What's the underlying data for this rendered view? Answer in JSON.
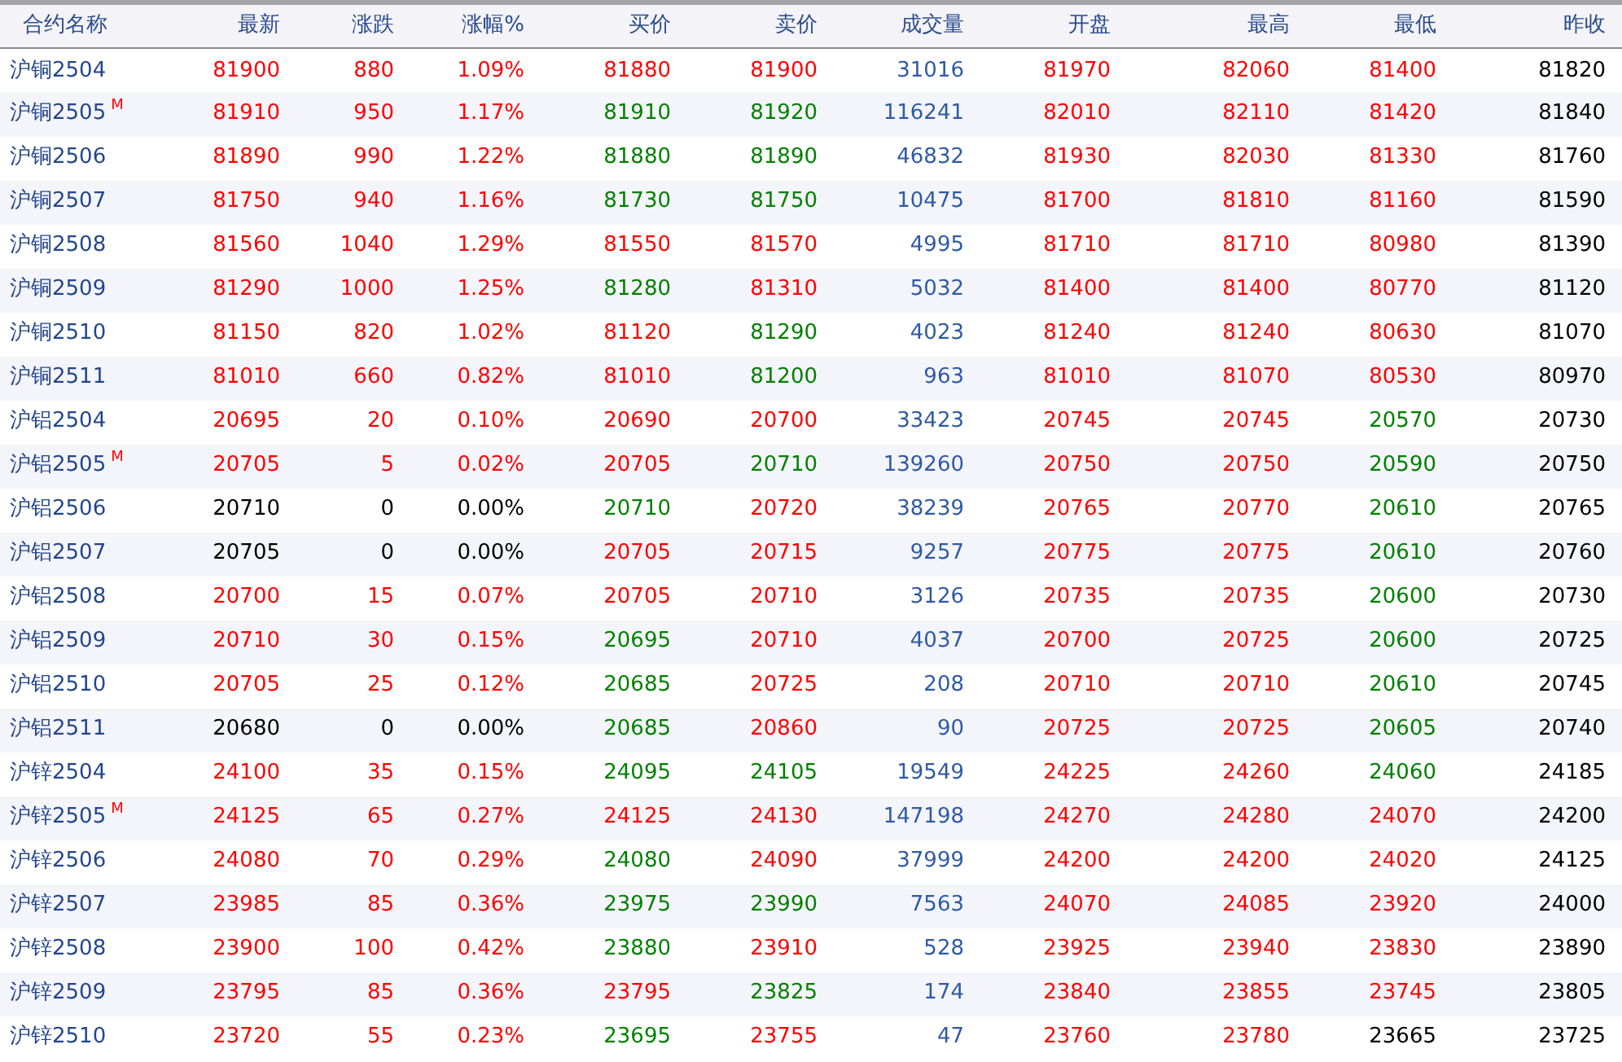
{
  "columns": [
    {
      "label": "合约名称",
      "kind": "name"
    },
    {
      "label": "最新",
      "kind": "price"
    },
    {
      "label": "涨跌",
      "kind": "price"
    },
    {
      "label": "涨幅%",
      "kind": "price"
    },
    {
      "label": "买价",
      "kind": "price"
    },
    {
      "label": "卖价",
      "kind": "price"
    },
    {
      "label": "成交量",
      "kind": "volume"
    },
    {
      "label": "开盘",
      "kind": "price"
    },
    {
      "label": "最高",
      "kind": "price"
    },
    {
      "label": "最低",
      "kind": "price"
    },
    {
      "label": "昨收",
      "kind": "close"
    }
  ],
  "rows": [
    {
      "name": "沪铜2504",
      "cells": [
        {
          "text": "81900",
          "color": "#ff0000"
        },
        {
          "text": "880",
          "color": "#ff0000"
        },
        {
          "text": "1.09%",
          "color": "#ff0000"
        },
        {
          "text": "81880",
          "color": "#ff0000"
        },
        {
          "text": "81900",
          "color": "#ff0000"
        },
        {
          "text": "31016"
        },
        {
          "text": "81970",
          "color": "#ff0000"
        },
        {
          "text": "82060",
          "color": "#ff0000"
        },
        {
          "text": "81400",
          "color": "#ff0000"
        },
        {
          "text": "81820"
        }
      ]
    },
    {
      "name": "沪铜2505",
      "badge": "M",
      "cells": [
        {
          "text": "81910",
          "color": "#ff0000"
        },
        {
          "text": "950",
          "color": "#ff0000"
        },
        {
          "text": "1.17%",
          "color": "#ff0000"
        },
        {
          "text": "81910",
          "color": "#008000"
        },
        {
          "text": "81920",
          "color": "#008000"
        },
        {
          "text": "116241"
        },
        {
          "text": "82010",
          "color": "#ff0000"
        },
        {
          "text": "82110",
          "color": "#ff0000"
        },
        {
          "text": "81420",
          "color": "#ff0000"
        },
        {
          "text": "81840"
        }
      ]
    },
    {
      "name": "沪铜2506",
      "cells": [
        {
          "text": "81890",
          "color": "#ff0000"
        },
        {
          "text": "990",
          "color": "#ff0000"
        },
        {
          "text": "1.22%",
          "color": "#ff0000"
        },
        {
          "text": "81880",
          "color": "#008000"
        },
        {
          "text": "81890",
          "color": "#008000"
        },
        {
          "text": "46832"
        },
        {
          "text": "81930",
          "color": "#ff0000"
        },
        {
          "text": "82030",
          "color": "#ff0000"
        },
        {
          "text": "81330",
          "color": "#ff0000"
        },
        {
          "text": "81760"
        }
      ]
    },
    {
      "name": "沪铜2507",
      "cells": [
        {
          "text": "81750",
          "color": "#ff0000"
        },
        {
          "text": "940",
          "color": "#ff0000"
        },
        {
          "text": "1.16%",
          "color": "#ff0000"
        },
        {
          "text": "81730",
          "color": "#008000"
        },
        {
          "text": "81750",
          "color": "#008000"
        },
        {
          "text": "10475"
        },
        {
          "text": "81700",
          "color": "#ff0000"
        },
        {
          "text": "81810",
          "color": "#ff0000"
        },
        {
          "text": "81160",
          "color": "#ff0000"
        },
        {
          "text": "81590"
        }
      ]
    },
    {
      "name": "沪铜2508",
      "cells": [
        {
          "text": "81560",
          "color": "#ff0000"
        },
        {
          "text": "1040",
          "color": "#ff0000"
        },
        {
          "text": "1.29%",
          "color": "#ff0000"
        },
        {
          "text": "81550",
          "color": "#ff0000"
        },
        {
          "text": "81570",
          "color": "#ff0000"
        },
        {
          "text": "4995"
        },
        {
          "text": "81710",
          "color": "#ff0000"
        },
        {
          "text": "81710",
          "color": "#ff0000"
        },
        {
          "text": "80980",
          "color": "#ff0000"
        },
        {
          "text": "81390"
        }
      ]
    },
    {
      "name": "沪铜2509",
      "cells": [
        {
          "text": "81290",
          "color": "#ff0000"
        },
        {
          "text": "1000",
          "color": "#ff0000"
        },
        {
          "text": "1.25%",
          "color": "#ff0000"
        },
        {
          "text": "81280",
          "color": "#008000"
        },
        {
          "text": "81310",
          "color": "#ff0000"
        },
        {
          "text": "5032"
        },
        {
          "text": "81400",
          "color": "#ff0000"
        },
        {
          "text": "81400",
          "color": "#ff0000"
        },
        {
          "text": "80770",
          "color": "#ff0000"
        },
        {
          "text": "81120"
        }
      ]
    },
    {
      "name": "沪铜2510",
      "cells": [
        {
          "text": "81150",
          "color": "#ff0000"
        },
        {
          "text": "820",
          "color": "#ff0000"
        },
        {
          "text": "1.02%",
          "color": "#ff0000"
        },
        {
          "text": "81120",
          "color": "#ff0000"
        },
        {
          "text": "81290",
          "color": "#008000"
        },
        {
          "text": "4023"
        },
        {
          "text": "81240",
          "color": "#ff0000"
        },
        {
          "text": "81240",
          "color": "#ff0000"
        },
        {
          "text": "80630",
          "color": "#ff0000"
        },
        {
          "text": "81070"
        }
      ]
    },
    {
      "name": "沪铜2511",
      "cells": [
        {
          "text": "81010",
          "color": "#ff0000"
        },
        {
          "text": "660",
          "color": "#ff0000"
        },
        {
          "text": "0.82%",
          "color": "#ff0000"
        },
        {
          "text": "81010",
          "color": "#ff0000"
        },
        {
          "text": "81200",
          "color": "#008000"
        },
        {
          "text": "963"
        },
        {
          "text": "81010",
          "color": "#ff0000"
        },
        {
          "text": "81070",
          "color": "#ff0000"
        },
        {
          "text": "80530",
          "color": "#ff0000"
        },
        {
          "text": "80970"
        }
      ]
    },
    {
      "name": "沪铝2504",
      "cells": [
        {
          "text": "20695",
          "color": "#ff0000"
        },
        {
          "text": "20",
          "color": "#ff0000"
        },
        {
          "text": "0.10%",
          "color": "#ff0000"
        },
        {
          "text": "20690",
          "color": "#ff0000"
        },
        {
          "text": "20700",
          "color": "#ff0000"
        },
        {
          "text": "33423"
        },
        {
          "text": "20745",
          "color": "#ff0000"
        },
        {
          "text": "20745",
          "color": "#ff0000"
        },
        {
          "text": "20570",
          "color": "#008000"
        },
        {
          "text": "20730"
        }
      ]
    },
    {
      "name": "沪铝2505",
      "badge": "M",
      "cells": [
        {
          "text": "20705",
          "color": "#ff0000"
        },
        {
          "text": "5",
          "color": "#ff0000"
        },
        {
          "text": "0.02%",
          "color": "#ff0000"
        },
        {
          "text": "20705",
          "color": "#ff0000"
        },
        {
          "text": "20710",
          "color": "#008000"
        },
        {
          "text": "139260"
        },
        {
          "text": "20750",
          "color": "#ff0000"
        },
        {
          "text": "20750",
          "color": "#ff0000"
        },
        {
          "text": "20590",
          "color": "#008000"
        },
        {
          "text": "20750"
        }
      ]
    },
    {
      "name": "沪铝2506",
      "cells": [
        {
          "text": "20710",
          "color": "#000000"
        },
        {
          "text": "0",
          "color": "#000000"
        },
        {
          "text": "0.00%",
          "color": "#000000"
        },
        {
          "text": "20710",
          "color": "#008000"
        },
        {
          "text": "20720",
          "color": "#ff0000"
        },
        {
          "text": "38239"
        },
        {
          "text": "20765",
          "color": "#ff0000"
        },
        {
          "text": "20770",
          "color": "#ff0000"
        },
        {
          "text": "20610",
          "color": "#008000"
        },
        {
          "text": "20765"
        }
      ]
    },
    {
      "name": "沪铝2507",
      "cells": [
        {
          "text": "20705",
          "color": "#000000"
        },
        {
          "text": "0",
          "color": "#000000"
        },
        {
          "text": "0.00%",
          "color": "#000000"
        },
        {
          "text": "20705",
          "color": "#ff0000"
        },
        {
          "text": "20715",
          "color": "#ff0000"
        },
        {
          "text": "9257"
        },
        {
          "text": "20775",
          "color": "#ff0000"
        },
        {
          "text": "20775",
          "color": "#ff0000"
        },
        {
          "text": "20610",
          "color": "#008000"
        },
        {
          "text": "20760"
        }
      ]
    },
    {
      "name": "沪铝2508",
      "cells": [
        {
          "text": "20700",
          "color": "#ff0000"
        },
        {
          "text": "15",
          "color": "#ff0000"
        },
        {
          "text": "0.07%",
          "color": "#ff0000"
        },
        {
          "text": "20705",
          "color": "#ff0000"
        },
        {
          "text": "20710",
          "color": "#ff0000"
        },
        {
          "text": "3126"
        },
        {
          "text": "20735",
          "color": "#ff0000"
        },
        {
          "text": "20735",
          "color": "#ff0000"
        },
        {
          "text": "20600",
          "color": "#008000"
        },
        {
          "text": "20730"
        }
      ]
    },
    {
      "name": "沪铝2509",
      "cells": [
        {
          "text": "20710",
          "color": "#ff0000"
        },
        {
          "text": "30",
          "color": "#ff0000"
        },
        {
          "text": "0.15%",
          "color": "#ff0000"
        },
        {
          "text": "20695",
          "color": "#008000"
        },
        {
          "text": "20710",
          "color": "#ff0000"
        },
        {
          "text": "4037"
        },
        {
          "text": "20700",
          "color": "#ff0000"
        },
        {
          "text": "20725",
          "color": "#ff0000"
        },
        {
          "text": "20600",
          "color": "#008000"
        },
        {
          "text": "20725"
        }
      ]
    },
    {
      "name": "沪铝2510",
      "cells": [
        {
          "text": "20705",
          "color": "#ff0000"
        },
        {
          "text": "25",
          "color": "#ff0000"
        },
        {
          "text": "0.12%",
          "color": "#ff0000"
        },
        {
          "text": "20685",
          "color": "#008000"
        },
        {
          "text": "20725",
          "color": "#ff0000"
        },
        {
          "text": "208"
        },
        {
          "text": "20710",
          "color": "#ff0000"
        },
        {
          "text": "20710",
          "color": "#ff0000"
        },
        {
          "text": "20610",
          "color": "#008000"
        },
        {
          "text": "20745"
        }
      ]
    },
    {
      "name": "沪铝2511",
      "cells": [
        {
          "text": "20680",
          "color": "#000000"
        },
        {
          "text": "0",
          "color": "#000000"
        },
        {
          "text": "0.00%",
          "color": "#000000"
        },
        {
          "text": "20685",
          "color": "#008000"
        },
        {
          "text": "20860",
          "color": "#ff0000"
        },
        {
          "text": "90"
        },
        {
          "text": "20725",
          "color": "#ff0000"
        },
        {
          "text": "20725",
          "color": "#ff0000"
        },
        {
          "text": "20605",
          "color": "#008000"
        },
        {
          "text": "20740"
        }
      ]
    },
    {
      "name": "沪锌2504",
      "cells": [
        {
          "text": "24100",
          "color": "#ff0000"
        },
        {
          "text": "35",
          "color": "#ff0000"
        },
        {
          "text": "0.15%",
          "color": "#ff0000"
        },
        {
          "text": "24095",
          "color": "#008000"
        },
        {
          "text": "24105",
          "color": "#008000"
        },
        {
          "text": "19549"
        },
        {
          "text": "24225",
          "color": "#ff0000"
        },
        {
          "text": "24260",
          "color": "#ff0000"
        },
        {
          "text": "24060",
          "color": "#008000"
        },
        {
          "text": "24185"
        }
      ]
    },
    {
      "name": "沪锌2505",
      "badge": "M",
      "cells": [
        {
          "text": "24125",
          "color": "#ff0000"
        },
        {
          "text": "65",
          "color": "#ff0000"
        },
        {
          "text": "0.27%",
          "color": "#ff0000"
        },
        {
          "text": "24125",
          "color": "#ff0000"
        },
        {
          "text": "24130",
          "color": "#ff0000"
        },
        {
          "text": "147198"
        },
        {
          "text": "24270",
          "color": "#ff0000"
        },
        {
          "text": "24280",
          "color": "#ff0000"
        },
        {
          "text": "24070",
          "color": "#ff0000"
        },
        {
          "text": "24200"
        }
      ]
    },
    {
      "name": "沪锌2506",
      "cells": [
        {
          "text": "24080",
          "color": "#ff0000"
        },
        {
          "text": "70",
          "color": "#ff0000"
        },
        {
          "text": "0.29%",
          "color": "#ff0000"
        },
        {
          "text": "24080",
          "color": "#008000"
        },
        {
          "text": "24090",
          "color": "#ff0000"
        },
        {
          "text": "37999"
        },
        {
          "text": "24200",
          "color": "#ff0000"
        },
        {
          "text": "24200",
          "color": "#ff0000"
        },
        {
          "text": "24020",
          "color": "#ff0000"
        },
        {
          "text": "24125"
        }
      ]
    },
    {
      "name": "沪锌2507",
      "cells": [
        {
          "text": "23985",
          "color": "#ff0000"
        },
        {
          "text": "85",
          "color": "#ff0000"
        },
        {
          "text": "0.36%",
          "color": "#ff0000"
        },
        {
          "text": "23975",
          "color": "#008000"
        },
        {
          "text": "23990",
          "color": "#008000"
        },
        {
          "text": "7563"
        },
        {
          "text": "24070",
          "color": "#ff0000"
        },
        {
          "text": "24085",
          "color": "#ff0000"
        },
        {
          "text": "23920",
          "color": "#ff0000"
        },
        {
          "text": "24000"
        }
      ]
    },
    {
      "name": "沪锌2508",
      "cells": [
        {
          "text": "23900",
          "color": "#ff0000"
        },
        {
          "text": "100",
          "color": "#ff0000"
        },
        {
          "text": "0.42%",
          "color": "#ff0000"
        },
        {
          "text": "23880",
          "color": "#008000"
        },
        {
          "text": "23910",
          "color": "#ff0000"
        },
        {
          "text": "528"
        },
        {
          "text": "23925",
          "color": "#ff0000"
        },
        {
          "text": "23940",
          "color": "#ff0000"
        },
        {
          "text": "23830",
          "color": "#ff0000"
        },
        {
          "text": "23890"
        }
      ]
    },
    {
      "name": "沪锌2509",
      "cells": [
        {
          "text": "23795",
          "color": "#ff0000"
        },
        {
          "text": "85",
          "color": "#ff0000"
        },
        {
          "text": "0.36%",
          "color": "#ff0000"
        },
        {
          "text": "23795",
          "color": "#ff0000"
        },
        {
          "text": "23825",
          "color": "#008000"
        },
        {
          "text": "174"
        },
        {
          "text": "23840",
          "color": "#ff0000"
        },
        {
          "text": "23855",
          "color": "#ff0000"
        },
        {
          "text": "23745",
          "color": "#ff0000"
        },
        {
          "text": "23805"
        }
      ]
    },
    {
      "name": "沪锌2510",
      "cells": [
        {
          "text": "23720",
          "color": "#ff0000"
        },
        {
          "text": "55",
          "color": "#ff0000"
        },
        {
          "text": "0.23%",
          "color": "#ff0000"
        },
        {
          "text": "23695",
          "color": "#008000"
        },
        {
          "text": "23755",
          "color": "#ff0000"
        },
        {
          "text": "47"
        },
        {
          "text": "23760",
          "color": "#ff0000"
        },
        {
          "text": "23780",
          "color": "#ff0000"
        },
        {
          "text": "23665",
          "color": "#000000"
        },
        {
          "text": "23725"
        }
      ]
    }
  ]
}
